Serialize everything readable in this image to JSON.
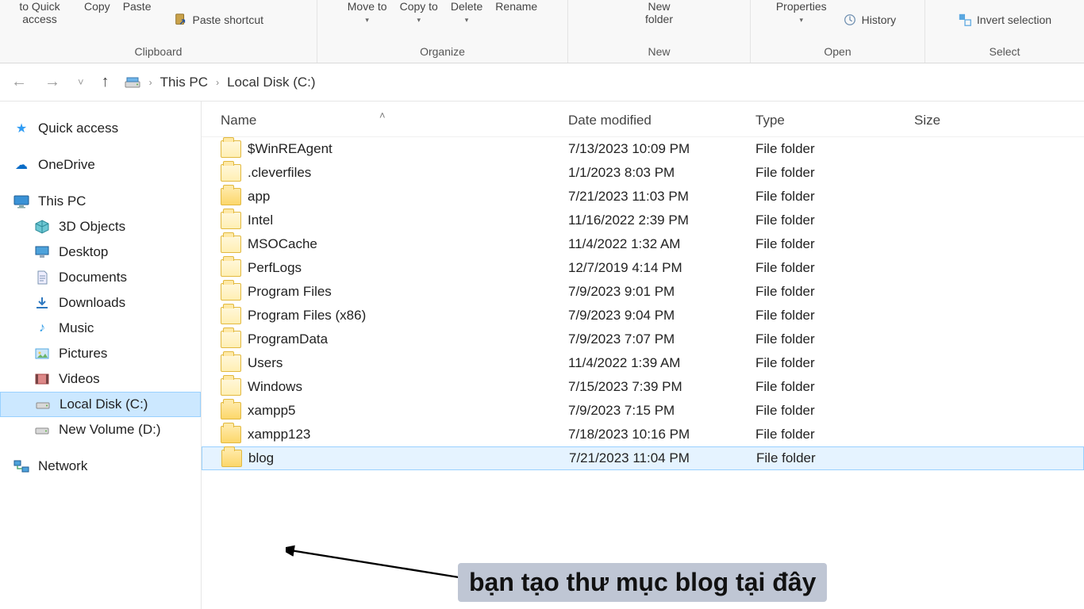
{
  "ribbon": {
    "pin": "to Quick access",
    "copy": "Copy",
    "paste": "Paste",
    "paste_shortcut": "Paste shortcut",
    "moveto": "Move to",
    "copyto": "Copy to",
    "delete": "Delete",
    "rename": "Rename",
    "newfolder": "New folder",
    "properties": "Properties",
    "history": "History",
    "invert": "Invert selection",
    "group_clipboard": "Clipboard",
    "group_organize": "Organize",
    "group_new": "New",
    "group_open": "Open",
    "group_select": "Select"
  },
  "breadcrumb": {
    "pc": "This PC",
    "disk": "Local Disk (C:)"
  },
  "tree": {
    "quick": "Quick access",
    "onedrive": "OneDrive",
    "thispc": "This PC",
    "objects3d": "3D Objects",
    "desktop": "Desktop",
    "documents": "Documents",
    "downloads": "Downloads",
    "music": "Music",
    "pictures": "Pictures",
    "videos": "Videos",
    "localdisk": "Local Disk (C:)",
    "newvol": "New Volume (D:)",
    "network": "Network"
  },
  "columns": {
    "name": "Name",
    "date": "Date modified",
    "type": "Type",
    "size": "Size"
  },
  "rows": [
    {
      "name": "$WinREAgent",
      "date": "7/13/2023 10:09 PM",
      "type": "File folder",
      "light": true
    },
    {
      "name": ".cleverfiles",
      "date": "1/1/2023 8:03 PM",
      "type": "File folder",
      "light": true
    },
    {
      "name": "app",
      "date": "7/21/2023 11:03 PM",
      "type": "File folder"
    },
    {
      "name": "Intel",
      "date": "11/16/2022 2:39 PM",
      "type": "File folder",
      "light": true
    },
    {
      "name": "MSOCache",
      "date": "11/4/2022 1:32 AM",
      "type": "File folder",
      "light": true
    },
    {
      "name": "PerfLogs",
      "date": "12/7/2019 4:14 PM",
      "type": "File folder",
      "light": true
    },
    {
      "name": "Program Files",
      "date": "7/9/2023 9:01 PM",
      "type": "File folder",
      "light": true
    },
    {
      "name": "Program Files (x86)",
      "date": "7/9/2023 9:04 PM",
      "type": "File folder",
      "light": true
    },
    {
      "name": "ProgramData",
      "date": "7/9/2023 7:07 PM",
      "type": "File folder",
      "light": true
    },
    {
      "name": "Users",
      "date": "11/4/2022 1:39 AM",
      "type": "File folder",
      "light": true
    },
    {
      "name": "Windows",
      "date": "7/15/2023 7:39 PM",
      "type": "File folder",
      "light": true
    },
    {
      "name": "xampp5",
      "date": "7/9/2023 7:15 PM",
      "type": "File folder"
    },
    {
      "name": "xampp123",
      "date": "7/18/2023 10:16 PM",
      "type": "File folder"
    },
    {
      "name": "blog",
      "date": "7/21/2023 11:04 PM",
      "type": "File folder",
      "selected": true
    }
  ],
  "annotation": "bạn tạo thư mục blog tại đây"
}
